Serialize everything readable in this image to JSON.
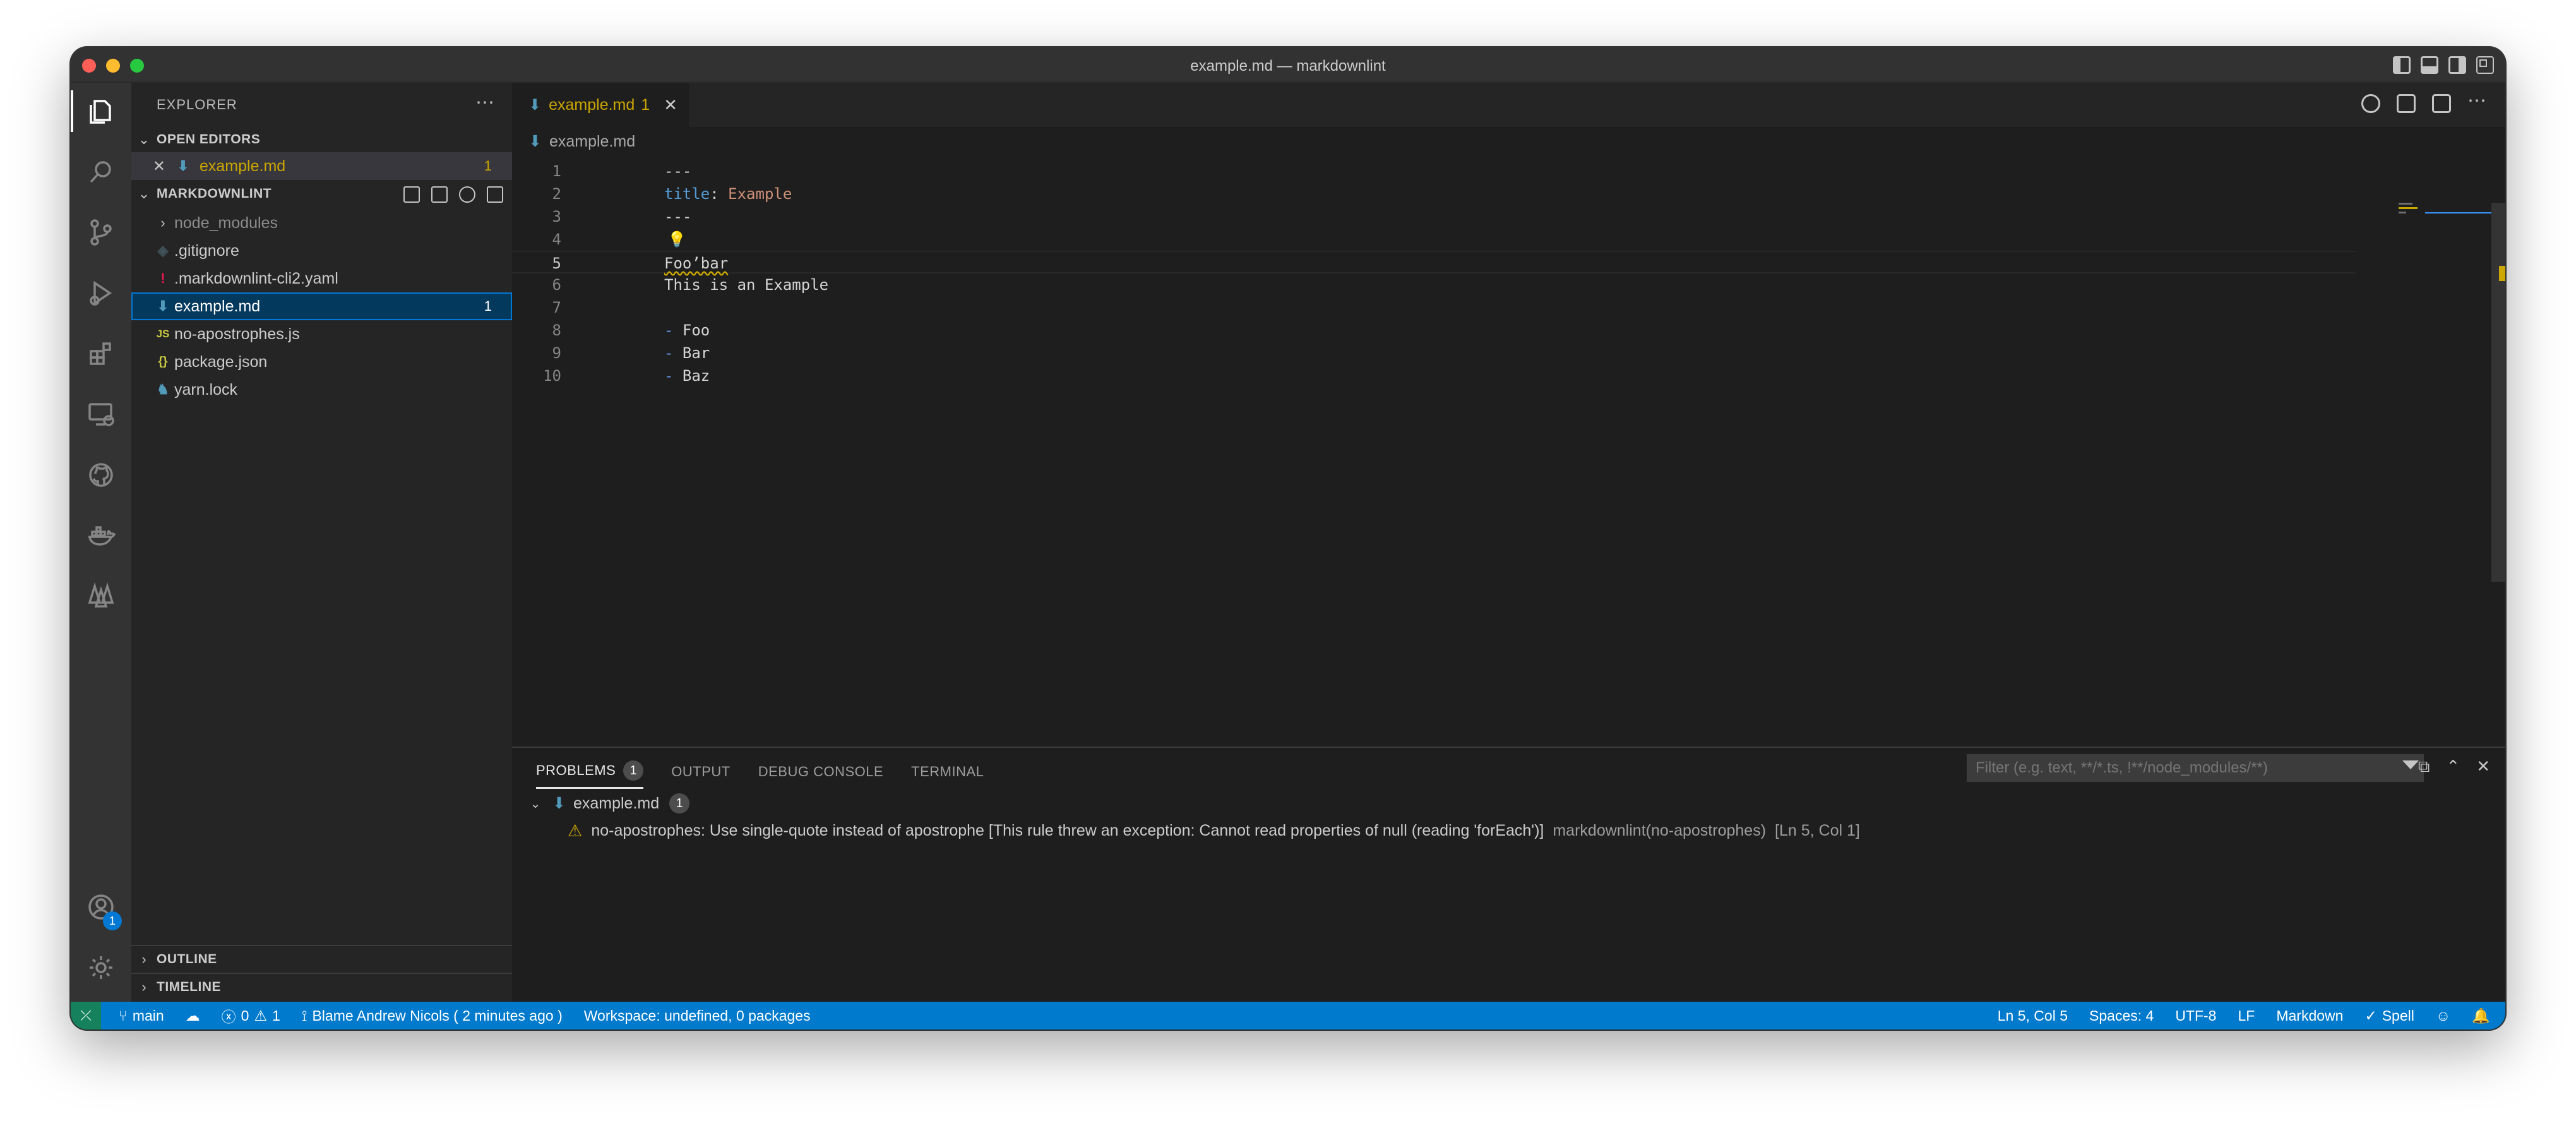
{
  "window": {
    "title": "example.md — markdownlint"
  },
  "activity": {
    "account_badge": "1"
  },
  "sidebar": {
    "title": "EXPLORER",
    "open_editors": {
      "title": "OPEN EDITORS",
      "items": [
        {
          "name": "example.md",
          "count": "1"
        }
      ]
    },
    "folder": {
      "title": "MARKDOWNLINT",
      "items": [
        {
          "name": "node_modules",
          "icon": "chevron-right-icon",
          "count": ""
        },
        {
          "name": ".gitignore",
          "icon": "git-file-icon",
          "count": ""
        },
        {
          "name": ".markdownlint-cli2.yaml",
          "icon": "yaml-file-icon",
          "count": ""
        },
        {
          "name": "example.md",
          "icon": "markdown-file-icon",
          "count": "1"
        },
        {
          "name": "no-apostrophes.js",
          "icon": "javascript-file-icon",
          "count": ""
        },
        {
          "name": "package.json",
          "icon": "json-file-icon",
          "count": ""
        },
        {
          "name": "yarn.lock",
          "icon": "yarn-file-icon",
          "count": ""
        }
      ]
    },
    "outline": "OUTLINE",
    "timeline": "TIMELINE"
  },
  "editor": {
    "tab": {
      "label": "example.md",
      "count": "1"
    },
    "breadcrumb": "example.md",
    "lines": [
      {
        "n": "1",
        "text": "---"
      },
      {
        "n": "2",
        "key": "title",
        "sep": ": ",
        "value": "Example"
      },
      {
        "n": "3",
        "text": "---"
      },
      {
        "n": "4",
        "text": ""
      },
      {
        "n": "5",
        "text": "Foo’bar"
      },
      {
        "n": "6",
        "text": "This is an Example"
      },
      {
        "n": "7",
        "text": ""
      },
      {
        "n": "8",
        "dash": "-",
        "text": " Foo"
      },
      {
        "n": "9",
        "dash": "-",
        "text": " Bar"
      },
      {
        "n": "10",
        "dash": "-",
        "text": " Baz"
      }
    ]
  },
  "panel": {
    "tabs": [
      {
        "label": "PROBLEMS",
        "count": "1"
      },
      {
        "label": "OUTPUT"
      },
      {
        "label": "DEBUG CONSOLE"
      },
      {
        "label": "TERMINAL"
      }
    ],
    "filter_placeholder": "Filter (e.g. text, **/*.ts, !**/node_modules/**)",
    "file": {
      "name": "example.md",
      "count": "1"
    },
    "problem": {
      "message": "no-apostrophes: Use single-quote instead of apostrophe [This rule threw an exception: Cannot read properties of null (reading 'forEach')]",
      "source": "markdownlint(no-apostrophes)",
      "location": "[Ln 5, Col 1]"
    }
  },
  "statusbar": {
    "branch": "main",
    "errors": "0",
    "warnings": "1",
    "blame": "Blame Andrew Nicols ( 2 minutes ago )",
    "workspace": "Workspace: undefined, 0 packages",
    "position": "Ln 5, Col 5",
    "spaces": "Spaces: 4",
    "encoding": "UTF-8",
    "eol": "LF",
    "language": "Markdown",
    "spell": "Spell"
  }
}
